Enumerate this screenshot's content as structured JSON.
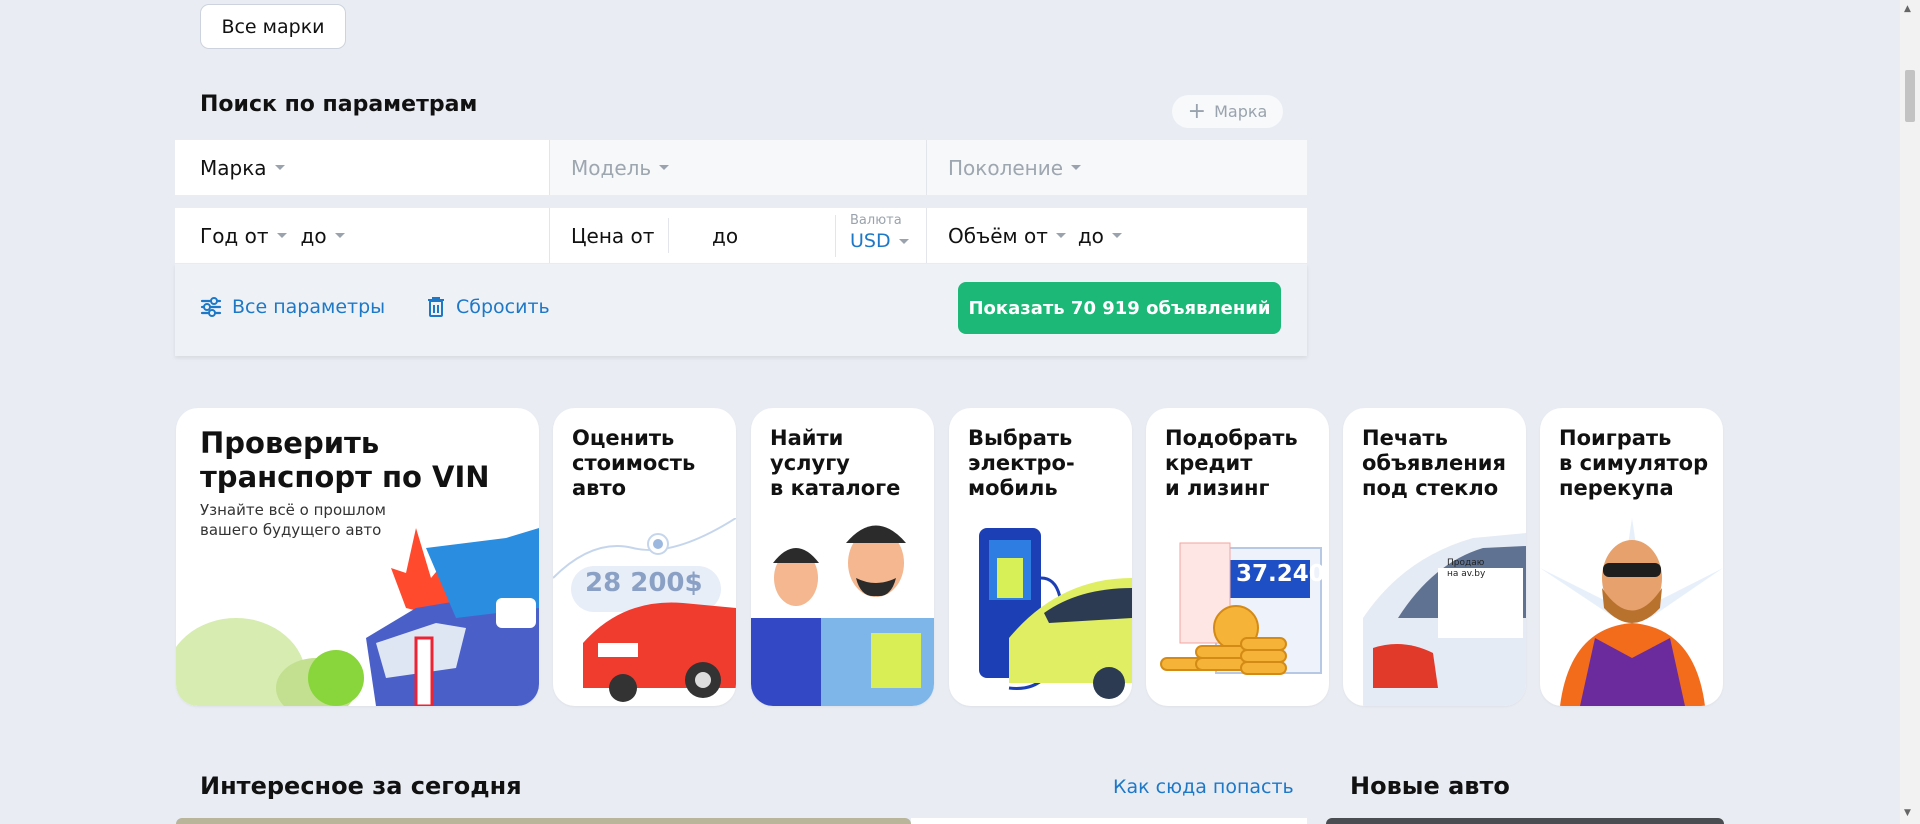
{
  "top": {
    "all_brands": "Все марки"
  },
  "search": {
    "title": "Поиск по параметрам",
    "add_brand": "Марка",
    "brand": "Марка",
    "model": "Модель",
    "generation": "Поколение",
    "year_from": "Год от",
    "year_to": "до",
    "price_from": "Цена от",
    "price_to": "до",
    "currency_label": "Валюта",
    "currency_value": "USD",
    "volume_from": "Объём от",
    "volume_to": "до",
    "all_params": "Все параметры",
    "reset": "Сбросить",
    "show_button": "Показать 70 919 объявлений"
  },
  "cards": [
    {
      "title": "Проверить\nтранспорт по VIN",
      "subtitle": "Узнайте всё о прошлом\nвашего будущего авто"
    },
    {
      "title": "Оценить\nстоимость\nавто",
      "price_badge": "28 200$"
    },
    {
      "title": "Найти\nуслугу\nв каталоге"
    },
    {
      "title": "Выбрать\nэлектро-\nмобиль"
    },
    {
      "title": "Подобрать\nкредит\nи лизинг",
      "counter": "37.240"
    },
    {
      "title": "Печать\nобъявления\nпод стекло",
      "sticker": "Продаю\nна av.by"
    },
    {
      "title": "Поиграть\nв симулятор\nперекупа"
    }
  ],
  "bottom": {
    "interesting_title": "Интересное за сегодня",
    "how_link": "Как сюда попасть",
    "new_cars_title": "Новые авто"
  },
  "colors": {
    "accent_green": "#1bb877",
    "link_blue": "#1e78c8",
    "bg": "#e9edf3"
  }
}
